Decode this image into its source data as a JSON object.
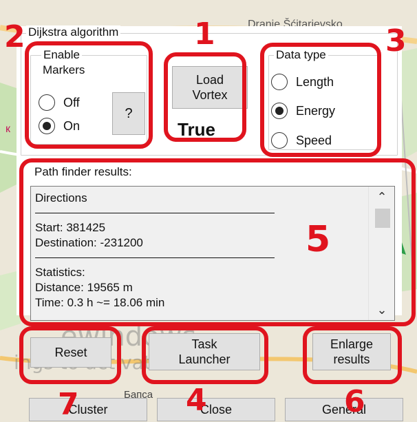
{
  "map": {
    "label_top": "Dranje Šćitarjevsko",
    "label_mid": "Бапса",
    "label_left": "к"
  },
  "dijkstra": {
    "title": "Dijkstra algorithm"
  },
  "markers": {
    "title_line1": "Enable",
    "title_line2": "Markers",
    "off_label": "Off",
    "on_label": "On",
    "selected": "On",
    "help_label": "?"
  },
  "vortex": {
    "load_line1": "Load",
    "load_line2": "Vortex",
    "status": "True"
  },
  "data_type": {
    "title": "Data type",
    "options": [
      "Length",
      "Energy",
      "Speed"
    ],
    "selected": "Energy"
  },
  "results": {
    "title": "Path finder results:",
    "header": "Directions",
    "start": "Start: 381425",
    "destination": "Destination: -231200",
    "stats_header": "Statistics:",
    "distance": "Distance: 19565 m",
    "time": "Time: 0.3 h  ~= 18.06 min"
  },
  "buttons": {
    "reset": "Reset",
    "task_line1": "Task",
    "task_line2": "Launcher",
    "enlarge_line1": "Enlarge",
    "enlarge_line2": "results",
    "cluster": "Cluster",
    "close": "Close",
    "general": "General"
  },
  "watermark": {
    "line1": "ewindows",
    "line2": "ings to activate Windows."
  },
  "annotations": {
    "n1": "1",
    "n2": "2",
    "n3": "3",
    "n4": "4",
    "n5": "5",
    "n6": "6",
    "n7": "7"
  },
  "colors": {
    "annotation_red": "#e0141e",
    "button_face": "#e1e1e1",
    "panel_bg": "#ffffff",
    "results_bg": "#f0f0f0"
  }
}
